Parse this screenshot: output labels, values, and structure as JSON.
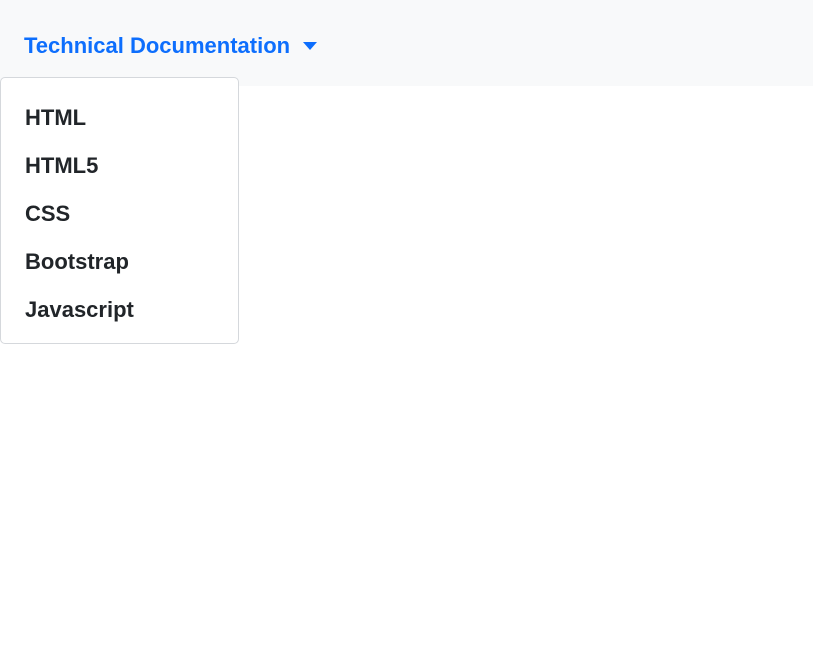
{
  "colors": {
    "accent": "#0d6efd",
    "text": "#212529",
    "navbar_bg": "#f8f9fa"
  },
  "navbar": {
    "dropdown_label": "Technical Documentation",
    "dropdown_icon": "caret-down-icon"
  },
  "dropdown": {
    "items": [
      {
        "label": "HTML"
      },
      {
        "label": "HTML5"
      },
      {
        "label": "CSS"
      },
      {
        "label": "Bootstrap"
      },
      {
        "label": "Javascript"
      }
    ]
  }
}
